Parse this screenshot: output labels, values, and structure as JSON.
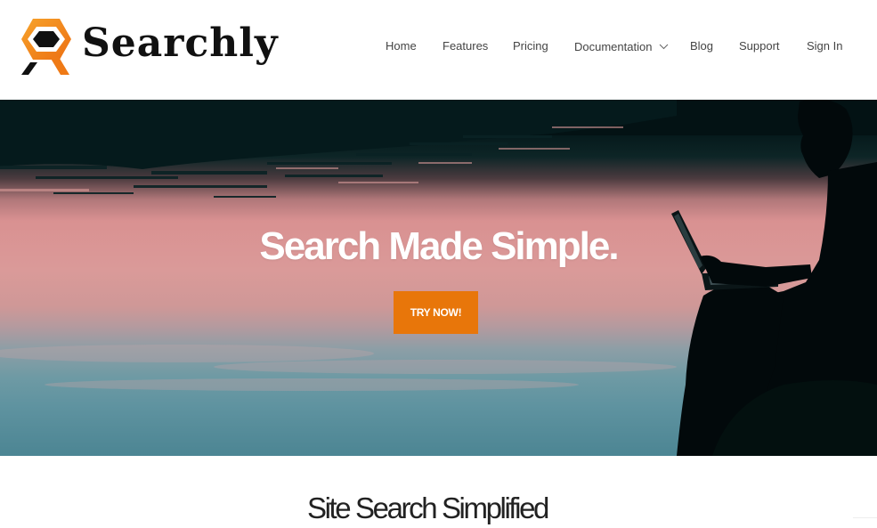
{
  "brand": {
    "name": "Searchly",
    "accent_color": "#e8760a",
    "logo_icon": "hexagon-magnifier-icon"
  },
  "nav": {
    "items": [
      {
        "label": "Home"
      },
      {
        "label": "Features"
      },
      {
        "label": "Pricing"
      },
      {
        "label": "Documentation",
        "has_dropdown": true,
        "dropdown_icon": "chevron-down-icon"
      },
      {
        "label": "Blog"
      },
      {
        "label": "Support"
      },
      {
        "label": "Sign In"
      }
    ]
  },
  "hero": {
    "title": "Search Made Simple.",
    "cta_label": "TRY NOW!",
    "background_image": "person-with-laptop-by-lake-at-sunset"
  },
  "section": {
    "title": "Site Search Simplified"
  }
}
